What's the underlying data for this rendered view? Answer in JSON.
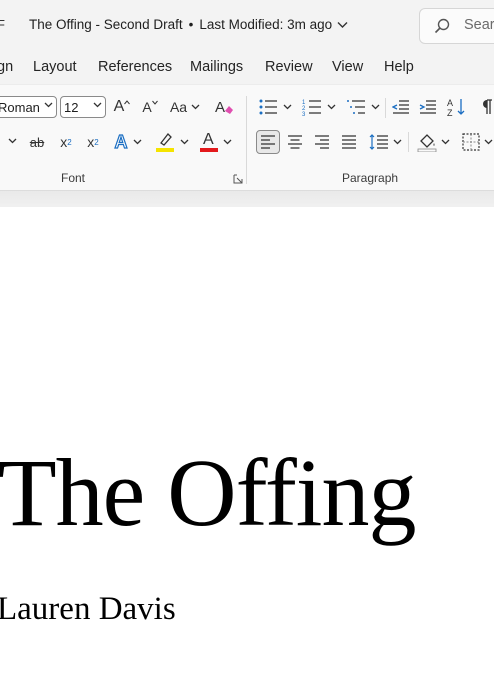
{
  "titlebar": {
    "left_fragment": "F",
    "doc_name": "The Offing - Second Draft",
    "separator": "•",
    "modified": "Last Modified: 3m ago",
    "search_placeholder": "Search"
  },
  "tabs": [
    {
      "label": "gn"
    },
    {
      "label": "Layout"
    },
    {
      "label": "References"
    },
    {
      "label": "Mailings"
    },
    {
      "label": "Review"
    },
    {
      "label": "View"
    },
    {
      "label": "Help"
    }
  ],
  "font": {
    "name_value": "Roman",
    "size_value": "12",
    "grow_label": "A",
    "shrink_label": "A",
    "case_label": "Aa",
    "strike_label": "ab",
    "subscript_label": "x",
    "subscript_small": "2",
    "superscript_label": "x",
    "superscript_small": "2",
    "effects_label": "A",
    "fontcolor_label": "A",
    "group_label": "Font"
  },
  "paragraph": {
    "group_label": "Paragraph"
  },
  "colors": {
    "highlight": "#f5e400",
    "font_color": "#e3191c",
    "text_effects": "#1b6ec2",
    "list_blue": "#1b6ec2"
  },
  "document": {
    "title": "The Offing",
    "author": "Lauren Davis"
  }
}
